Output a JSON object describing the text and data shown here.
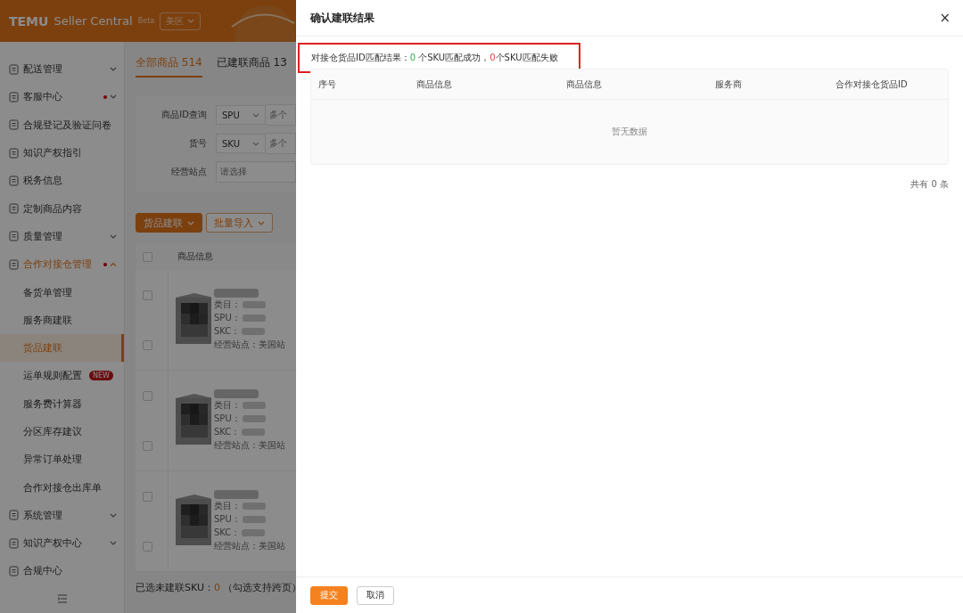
{
  "header": {
    "logo": "TEMU",
    "product": "Seller Central",
    "beta": "Beta",
    "region": "美区"
  },
  "sidebar": {
    "items": [
      {
        "label": "配送管理",
        "kind": "group",
        "expanded": false,
        "dot": false,
        "selected": false
      },
      {
        "label": "客服中心",
        "kind": "group",
        "expanded": false,
        "dot": true,
        "selected": false
      },
      {
        "label": "合规登记及验证问卷",
        "kind": "link",
        "selected": false
      },
      {
        "label": "知识产权指引",
        "kind": "link",
        "selected": false
      },
      {
        "label": "税务信息",
        "kind": "link",
        "selected": false
      },
      {
        "label": "定制商品内容",
        "kind": "link",
        "selected": false
      },
      {
        "label": "质量管理",
        "kind": "group",
        "expanded": false,
        "dot": false,
        "selected": false
      },
      {
        "label": "合作对接仓管理",
        "kind": "group",
        "expanded": true,
        "dot": true,
        "selected": false,
        "children": [
          {
            "label": "备货单管理",
            "selected": false
          },
          {
            "label": "服务商建联",
            "selected": false
          },
          {
            "label": "货品建联",
            "selected": true
          },
          {
            "label": "运单规则配置",
            "badge": "NEW",
            "selected": false
          },
          {
            "label": "服务费计算器",
            "selected": false
          },
          {
            "label": "分区库存建议",
            "selected": false
          },
          {
            "label": "异常订单处理",
            "selected": false
          },
          {
            "label": "合作对接仓出库单",
            "selected": false
          }
        ]
      },
      {
        "label": "系统管理",
        "kind": "group",
        "expanded": false,
        "dot": false,
        "selected": false
      },
      {
        "label": "知识产权中心",
        "kind": "group",
        "expanded": false,
        "dot": false,
        "selected": false
      },
      {
        "label": "合规中心",
        "kind": "link",
        "selected": false
      }
    ]
  },
  "tabs": [
    {
      "label": "全部商品 514",
      "selected": true
    },
    {
      "label": "已建联商品 13",
      "selected": false
    }
  ],
  "filters": [
    {
      "label": "商品ID查询",
      "select": "SPU",
      "placeholder": "多个"
    },
    {
      "label": "货号",
      "select": "SKU",
      "placeholder": "多个"
    },
    {
      "label": "经营站点",
      "placeholder": "请选择"
    }
  ],
  "actions": [
    {
      "label": "货品建联",
      "kind": "primary"
    },
    {
      "label": "批量导入",
      "kind": "outline"
    }
  ],
  "product_table": {
    "all_checked": false,
    "columns": [
      "商品信息"
    ],
    "rows": [
      {
        "kind": "picture",
        "skus": [
          {
            "checked": false
          },
          {
            "checked": false
          }
        ],
        "lines": [
          "类目：",
          "SPU：",
          "SKC：",
          "经营站点：美国站"
        ]
      },
      {
        "kind": "picture",
        "skus": [
          {
            "checked": false
          },
          {
            "checked": false
          }
        ],
        "lines": [
          "类目：",
          "SPU：",
          "SKC：",
          "经营站点：美国站"
        ]
      },
      {
        "kind": "picture",
        "skus": [
          {
            "checked": false
          },
          {
            "checked": false
          }
        ],
        "lines": [
          "类目：",
          "SPU：",
          "SKC：",
          "经营站点：美国站"
        ]
      }
    ]
  },
  "selection_footer": {
    "label": "已选未建联SKU：",
    "count": "0",
    "note": "（勾选支持跨页）"
  },
  "drawer": {
    "title": "确认建联结果",
    "close": "×",
    "summary": {
      "label": "对接仓货品ID匹配结果：",
      "success_count": "0",
      "success_text": " 个SKU匹配成功，",
      "fail_count": "0",
      "fail_text": "个SKU匹配失败"
    },
    "table": {
      "columns": [
        "序号",
        "商品信息",
        "商品信息",
        "服务商",
        "合作对接仓货品ID"
      ],
      "empty": "暂无数据"
    },
    "total": "共有 0 条",
    "buttons": [
      {
        "label": "提交",
        "kind": "primary"
      },
      {
        "label": "取消",
        "kind": "default"
      }
    ]
  }
}
